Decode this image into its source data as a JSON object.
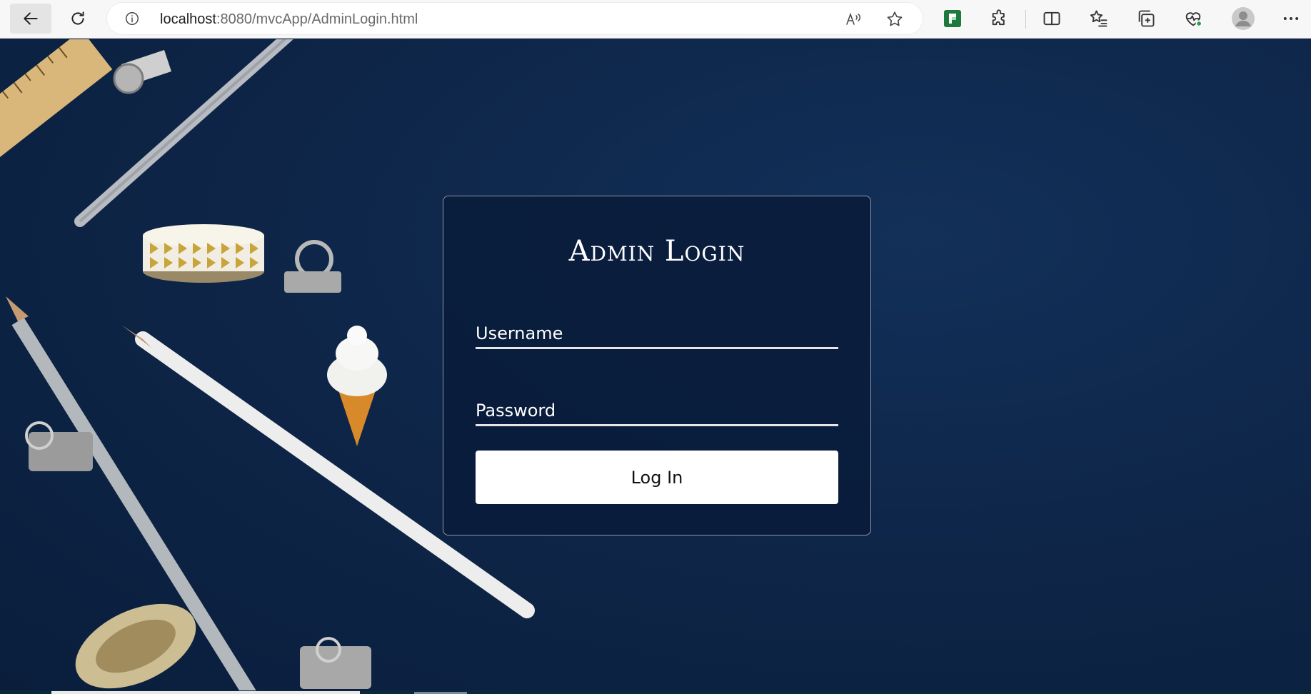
{
  "browser": {
    "url_host": "localhost",
    "url_rest": ":8080/mvcApp/AdminLogin.html",
    "icons": {
      "back": "back-arrow-icon",
      "reload": "reload-icon",
      "info": "info-icon",
      "read_aloud": "read-aloud-icon",
      "favorite": "star-icon",
      "extension": "green-extension-icon",
      "extensions": "puzzle-icon",
      "split_screen": "split-screen-icon",
      "favorites": "favorites-list-icon",
      "collections": "collections-icon",
      "browser_essentials": "heart-pulse-icon",
      "profile": "avatar-icon",
      "more": "more-dots-icon"
    }
  },
  "login": {
    "title": "Admin Login",
    "username_placeholder": "Username",
    "password_placeholder": "Password",
    "submit_label": "Log In"
  },
  "colors": {
    "page_background": "#0d2245",
    "card_border": "#ffffff",
    "button_background": "#ffffff"
  }
}
